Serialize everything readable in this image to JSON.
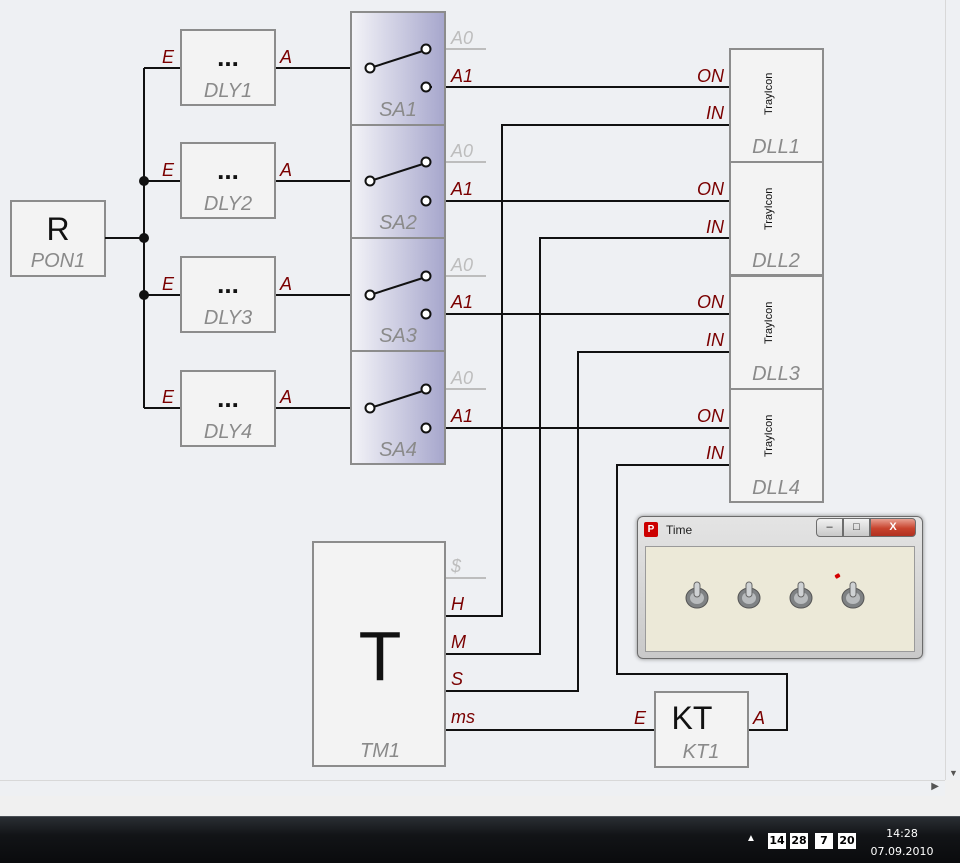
{
  "blocks": {
    "pon1": {
      "symbol": "R",
      "name": "PON1"
    },
    "dly": [
      {
        "symbol": "...",
        "name": "DLY1",
        "in_pin": "E",
        "out_pin": "A"
      },
      {
        "symbol": "...",
        "name": "DLY2",
        "in_pin": "E",
        "out_pin": "A"
      },
      {
        "symbol": "...",
        "name": "DLY3",
        "in_pin": "E",
        "out_pin": "A"
      },
      {
        "symbol": "...",
        "name": "DLY4",
        "in_pin": "E",
        "out_pin": "A"
      }
    ],
    "sa": [
      {
        "name": "SA1",
        "pin0": "A0",
        "pin1": "A1"
      },
      {
        "name": "SA2",
        "pin0": "A0",
        "pin1": "A1"
      },
      {
        "name": "SA3",
        "pin0": "A0",
        "pin1": "A1"
      },
      {
        "name": "SA4",
        "pin0": "A0",
        "pin1": "A1"
      }
    ],
    "dll": [
      {
        "name": "DLL1",
        "label": "TrayIcon",
        "on_pin": "ON",
        "in_pin": "IN"
      },
      {
        "name": "DLL2",
        "label": "TrayIcon",
        "on_pin": "ON",
        "in_pin": "IN"
      },
      {
        "name": "DLL3",
        "label": "TrayIcon",
        "on_pin": "ON",
        "in_pin": "IN"
      },
      {
        "name": "DLL4",
        "label": "TrayIcon",
        "on_pin": "ON",
        "in_pin": "IN"
      }
    ],
    "tm1": {
      "symbol": "T",
      "name": "TM1",
      "pins": [
        "$",
        "H",
        "M",
        "S",
        "ms"
      ]
    },
    "kt1": {
      "symbol": "KT",
      "name": "KT1",
      "in_pin": "E",
      "out_pin": "A"
    }
  },
  "time_window": {
    "icon": "P",
    "title": "Time",
    "minimize": "–",
    "maximize": "□",
    "close": "X",
    "toggle_count": 4,
    "indicator_color": "#d40000"
  },
  "taskbar": {
    "tray_arrow": "▲",
    "tray_numbers": [
      "14",
      "28",
      "7",
      "20"
    ],
    "time": "14:28",
    "date": "07.09.2010"
  },
  "colors": {
    "pin_label": "#7a0000",
    "block_name": "#8a8a8a",
    "switch_block_gradient": [
      "#f4f4f8",
      "#a6a6cc"
    ]
  }
}
